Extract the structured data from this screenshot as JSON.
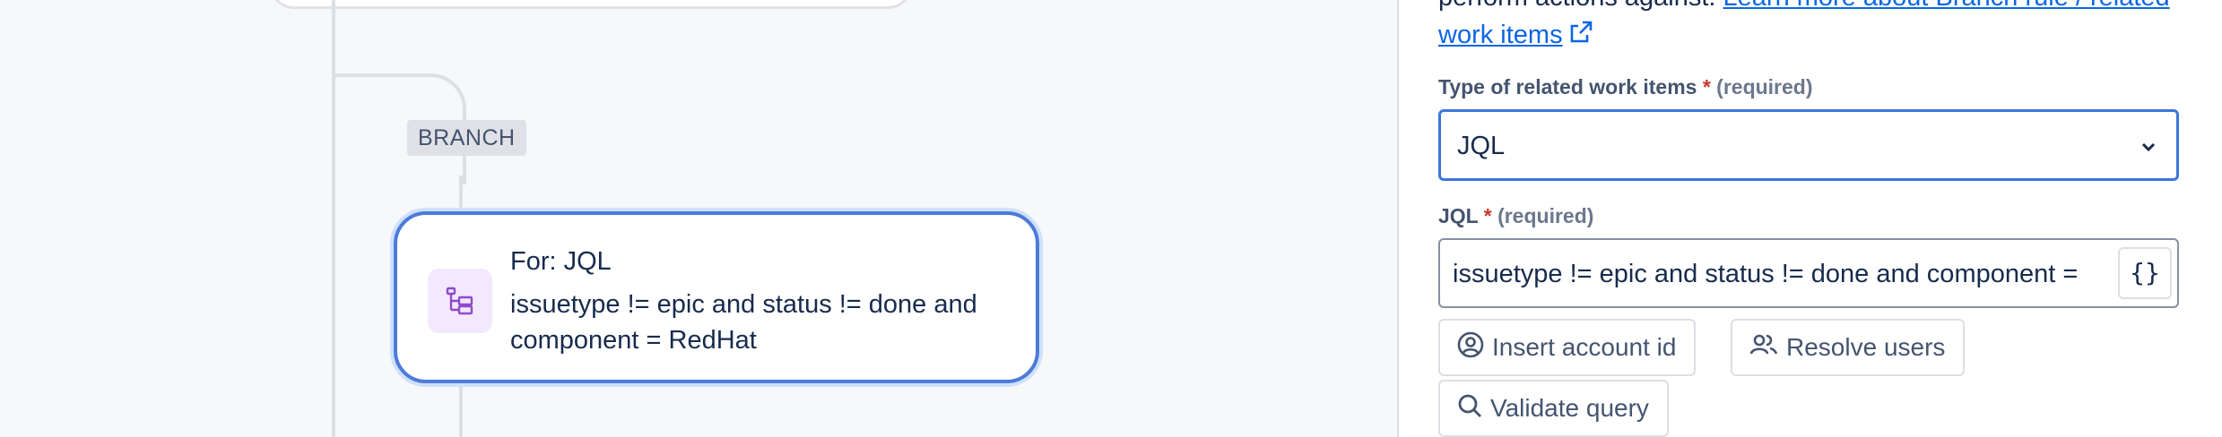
{
  "canvas": {
    "branch_label": "BRANCH",
    "node": {
      "title": "For: JQL",
      "body": "issuetype != epic and status != done and component = RedHat",
      "icon": "branch-tree-icon"
    }
  },
  "panel": {
    "help_text_prefix": "perform actions against.",
    "help_link": "Learn more about Branch rule / related work items",
    "type_field": {
      "label": "Type of related work items",
      "required_mark": "*",
      "required_text": "(required)",
      "value": "JQL"
    },
    "jql_field": {
      "label": "JQL",
      "required_mark": "*",
      "required_text": "(required)",
      "value": "issuetype != epic and status != done and component = ",
      "smart_values_button": "{}"
    },
    "buttons": {
      "insert_account_id": "Insert account id",
      "resolve_users": "Resolve users",
      "validate_query": "Validate query"
    }
  },
  "colors": {
    "accent": "#0c66e4",
    "node_border": "#4c7bd9",
    "required": "#c9372c",
    "icon_bg": "#f3e8fd",
    "icon_fg": "#8f4bc9"
  }
}
